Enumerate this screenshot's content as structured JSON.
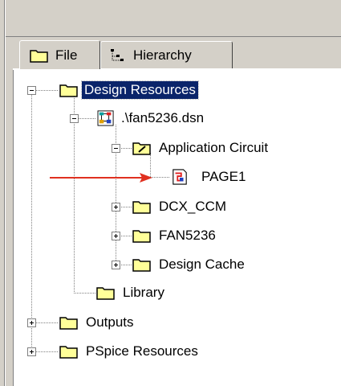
{
  "tabs": [
    {
      "label": "File",
      "icon": "folder-icon"
    },
    {
      "label": "Hierarchy",
      "icon": "hierarchy-icon"
    }
  ],
  "tree": {
    "design_resources": "Design Resources",
    "dsn_file": ".\\fan5236.dsn",
    "application_circuit": "Application Circuit",
    "page1": "PAGE1",
    "dcx_ccm": "DCX_CCM",
    "fan5236": "FAN5236",
    "design_cache": "Design Cache",
    "library": "Library",
    "outputs": "Outputs",
    "pspice_resources": "PSpice Resources"
  },
  "colors": {
    "selection": "#0a246a",
    "folder": "#ffff99",
    "arrow": "#e03020"
  }
}
